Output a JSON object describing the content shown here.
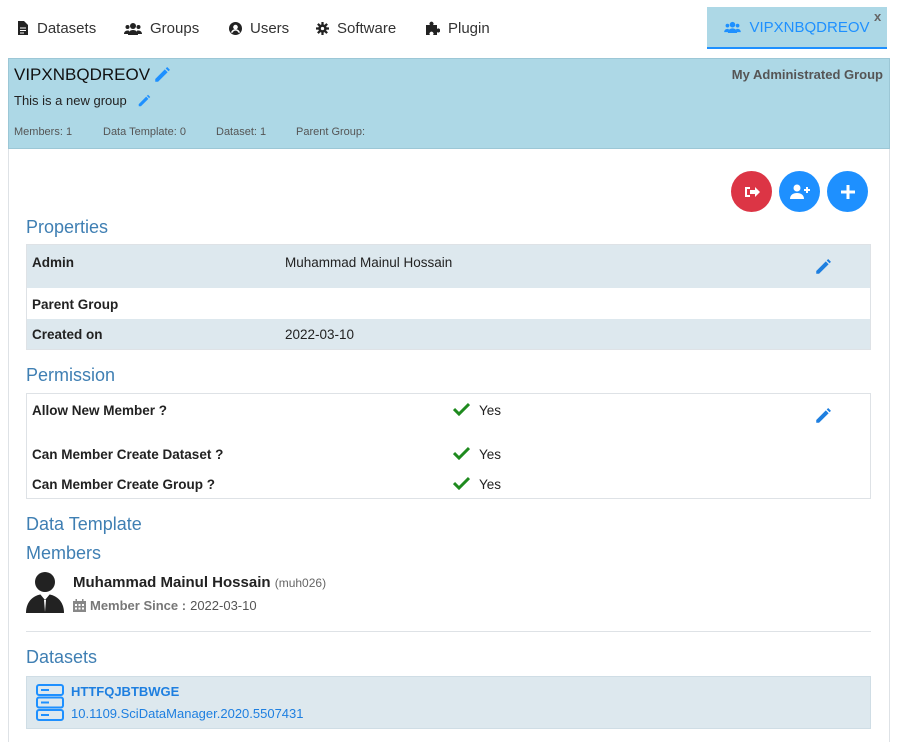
{
  "nav": {
    "items": [
      {
        "label": "Datasets"
      },
      {
        "label": "Groups"
      },
      {
        "label": "Users"
      },
      {
        "label": "Software"
      },
      {
        "label": "Plugin"
      }
    ],
    "active_tab": {
      "label": "VIPXNBQDREOV",
      "close": "x"
    }
  },
  "group": {
    "name": "VIPXNBQDREOV",
    "description": "This is a new group",
    "tag": "My Administrated Group",
    "stats": {
      "members": "Members: 1",
      "data_template": "Data Template: 0",
      "dataset": "Dataset: 1",
      "parent_group": "Parent Group:"
    }
  },
  "colors": {
    "header_bg": "#add8e6",
    "accent": "#1e90ff",
    "danger": "#dc3545",
    "title": "#3f7fb3",
    "check": "#1e8a1e"
  },
  "properties": {
    "title": "Properties",
    "rows": [
      {
        "label": "Admin",
        "value": "Muhammad Mainul Hossain"
      },
      {
        "label": "Parent Group",
        "value": ""
      },
      {
        "label": "Created on",
        "value": "2022-03-10"
      }
    ]
  },
  "permission": {
    "title": "Permission",
    "rows": [
      {
        "label": "Allow New Member ?",
        "value": "Yes"
      },
      {
        "label": "Can Member Create Dataset ?",
        "value": "Yes"
      },
      {
        "label": "Can Member Create Group ?",
        "value": "Yes"
      }
    ]
  },
  "data_template": {
    "title": "Data Template"
  },
  "members": {
    "title": "Members",
    "list": [
      {
        "name": "Muhammad Mainul Hossain",
        "username": "(muh026)",
        "since_label": "Member Since :",
        "since": "2022-03-10"
      }
    ]
  },
  "datasets": {
    "title": "Datasets",
    "list": [
      {
        "name": "HTTFQJBTBWGE",
        "doi": "10.1109.SciDataManager.2020.5507431"
      }
    ]
  }
}
